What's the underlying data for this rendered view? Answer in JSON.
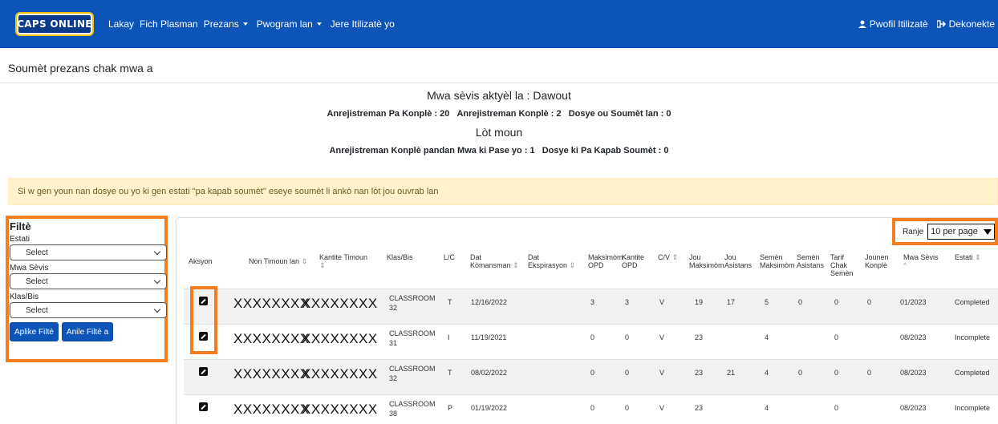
{
  "nav": {
    "brand": "CAPS ONLINE",
    "links": [
      "Lakay",
      "Fich Plasman",
      "Prezans",
      "Pwogram lan",
      "Jere Itilizatè yo"
    ],
    "profile": "Pwofil Itilizatè",
    "logout": "Dekonekte"
  },
  "page": {
    "title": "Soumèt prezans chak mwa a"
  },
  "summary": {
    "current_title": "Mwa sèvis aktyèl la : Dawout",
    "incomplete": "Anrejistreman Pa Konplè : 20",
    "complete": "Anrejistreman Konplè : 2",
    "submitted": "Dosye ou Soumèt lan : 0",
    "other_title": "Lòt moun",
    "past_complete": "Anrejistreman Konplè pandan Mwa ki Pase yo : 1",
    "cannot_submit": "Dosye ki Pa Kapab Soumèt : 0"
  },
  "alert": "Si w gen youn nan dosye ou yo ki gen estati \"pa kapab soumèt\" eseye soumèt li ankò nan lòt jou ouvrab lan",
  "filter": {
    "title": "Filtè",
    "labels": [
      "Estati",
      "Mwa Sèvis",
      "Klas/Bis"
    ],
    "select_value": "Select",
    "apply": "Aplike Filtè",
    "clear": "Anile Filtè a"
  },
  "range": {
    "label": "Ranje",
    "value": "10 per page"
  },
  "table": {
    "headers": {
      "action": "Aksyon",
      "child_name": "Non Timoun lan",
      "child_count": "Kantite Timoun",
      "class": "Klas/Bis",
      "lc": "L/C",
      "start1": "Dat",
      "start2": "Kòmansman",
      "exp1": "Dat",
      "exp2": "Ekspirasyon",
      "maxopd1": "Maksimòm",
      "maxopd2": "OPD",
      "cntopd1": "Kantite",
      "cntopd2": "OPD",
      "cv": "C/V",
      "maxday1": "Jou",
      "maxday2": "Maksimòm",
      "attday1": "Jou",
      "attday2": "Asistans",
      "maxweek1": "Semèn",
      "maxweek2": "Maksimòm",
      "attweek1": "Semèn",
      "attweek2": "Asistans",
      "rate1": "Tarif",
      "rate2": "Chak",
      "rate3": "Semèn",
      "full1": "Jounen",
      "full2": "Konplè",
      "month1": "Mwa Sèvis",
      "status": "Estati"
    },
    "rows": [
      {
        "name": "XXXXXXXX",
        "count": "XXXXXXXX",
        "cls1": "CLASSROOM",
        "cls2": "32",
        "lc": "T",
        "start": "12/16/2022",
        "exp": "",
        "maxopd": "3",
        "cntopd": "3",
        "cv": "V",
        "maxday": "19",
        "attday": "17",
        "maxweek": "5",
        "attweek": "0",
        "rate": "0",
        "full": "0",
        "month": "01/2023",
        "status": "Completed"
      },
      {
        "name": "XXXXXXXX",
        "count": "XXXXXXXX",
        "cls1": "CLASSROOM",
        "cls2": "31",
        "lc": "I",
        "start": "11/19/2021",
        "exp": "",
        "maxopd": "0",
        "cntopd": "0",
        "cv": "V",
        "maxday": "23",
        "attday": "",
        "maxweek": "4",
        "attweek": "",
        "rate": "0",
        "full": "",
        "month": "08/2023",
        "status": "Incomplete"
      },
      {
        "name": "XXXXXXXX",
        "count": "XXXXXXXX",
        "cls1": "CLASSROOM",
        "cls2": "32",
        "lc": "T",
        "start": "08/02/2022",
        "exp": "",
        "maxopd": "0",
        "cntopd": "0",
        "cv": "V",
        "maxday": "23",
        "attday": "21",
        "maxweek": "4",
        "attweek": "0",
        "rate": "0",
        "full": "0",
        "month": "08/2023",
        "status": "Completed"
      },
      {
        "name": "XXXXXXXX",
        "count": "XXXXXXXX",
        "cls1": "CLASSROOM",
        "cls2": "38",
        "lc": "P",
        "start": "01/19/2022",
        "exp": "",
        "maxopd": "0",
        "cntopd": "0",
        "cv": "V",
        "maxday": "23",
        "attday": "",
        "maxweek": "4",
        "attweek": "",
        "rate": "0",
        "full": "",
        "month": "08/2023",
        "status": "Incomplete"
      }
    ]
  },
  "colors": {
    "nav": "#0d54b8",
    "highlight": "#f47d20",
    "alert_bg": "#fff3cd"
  }
}
